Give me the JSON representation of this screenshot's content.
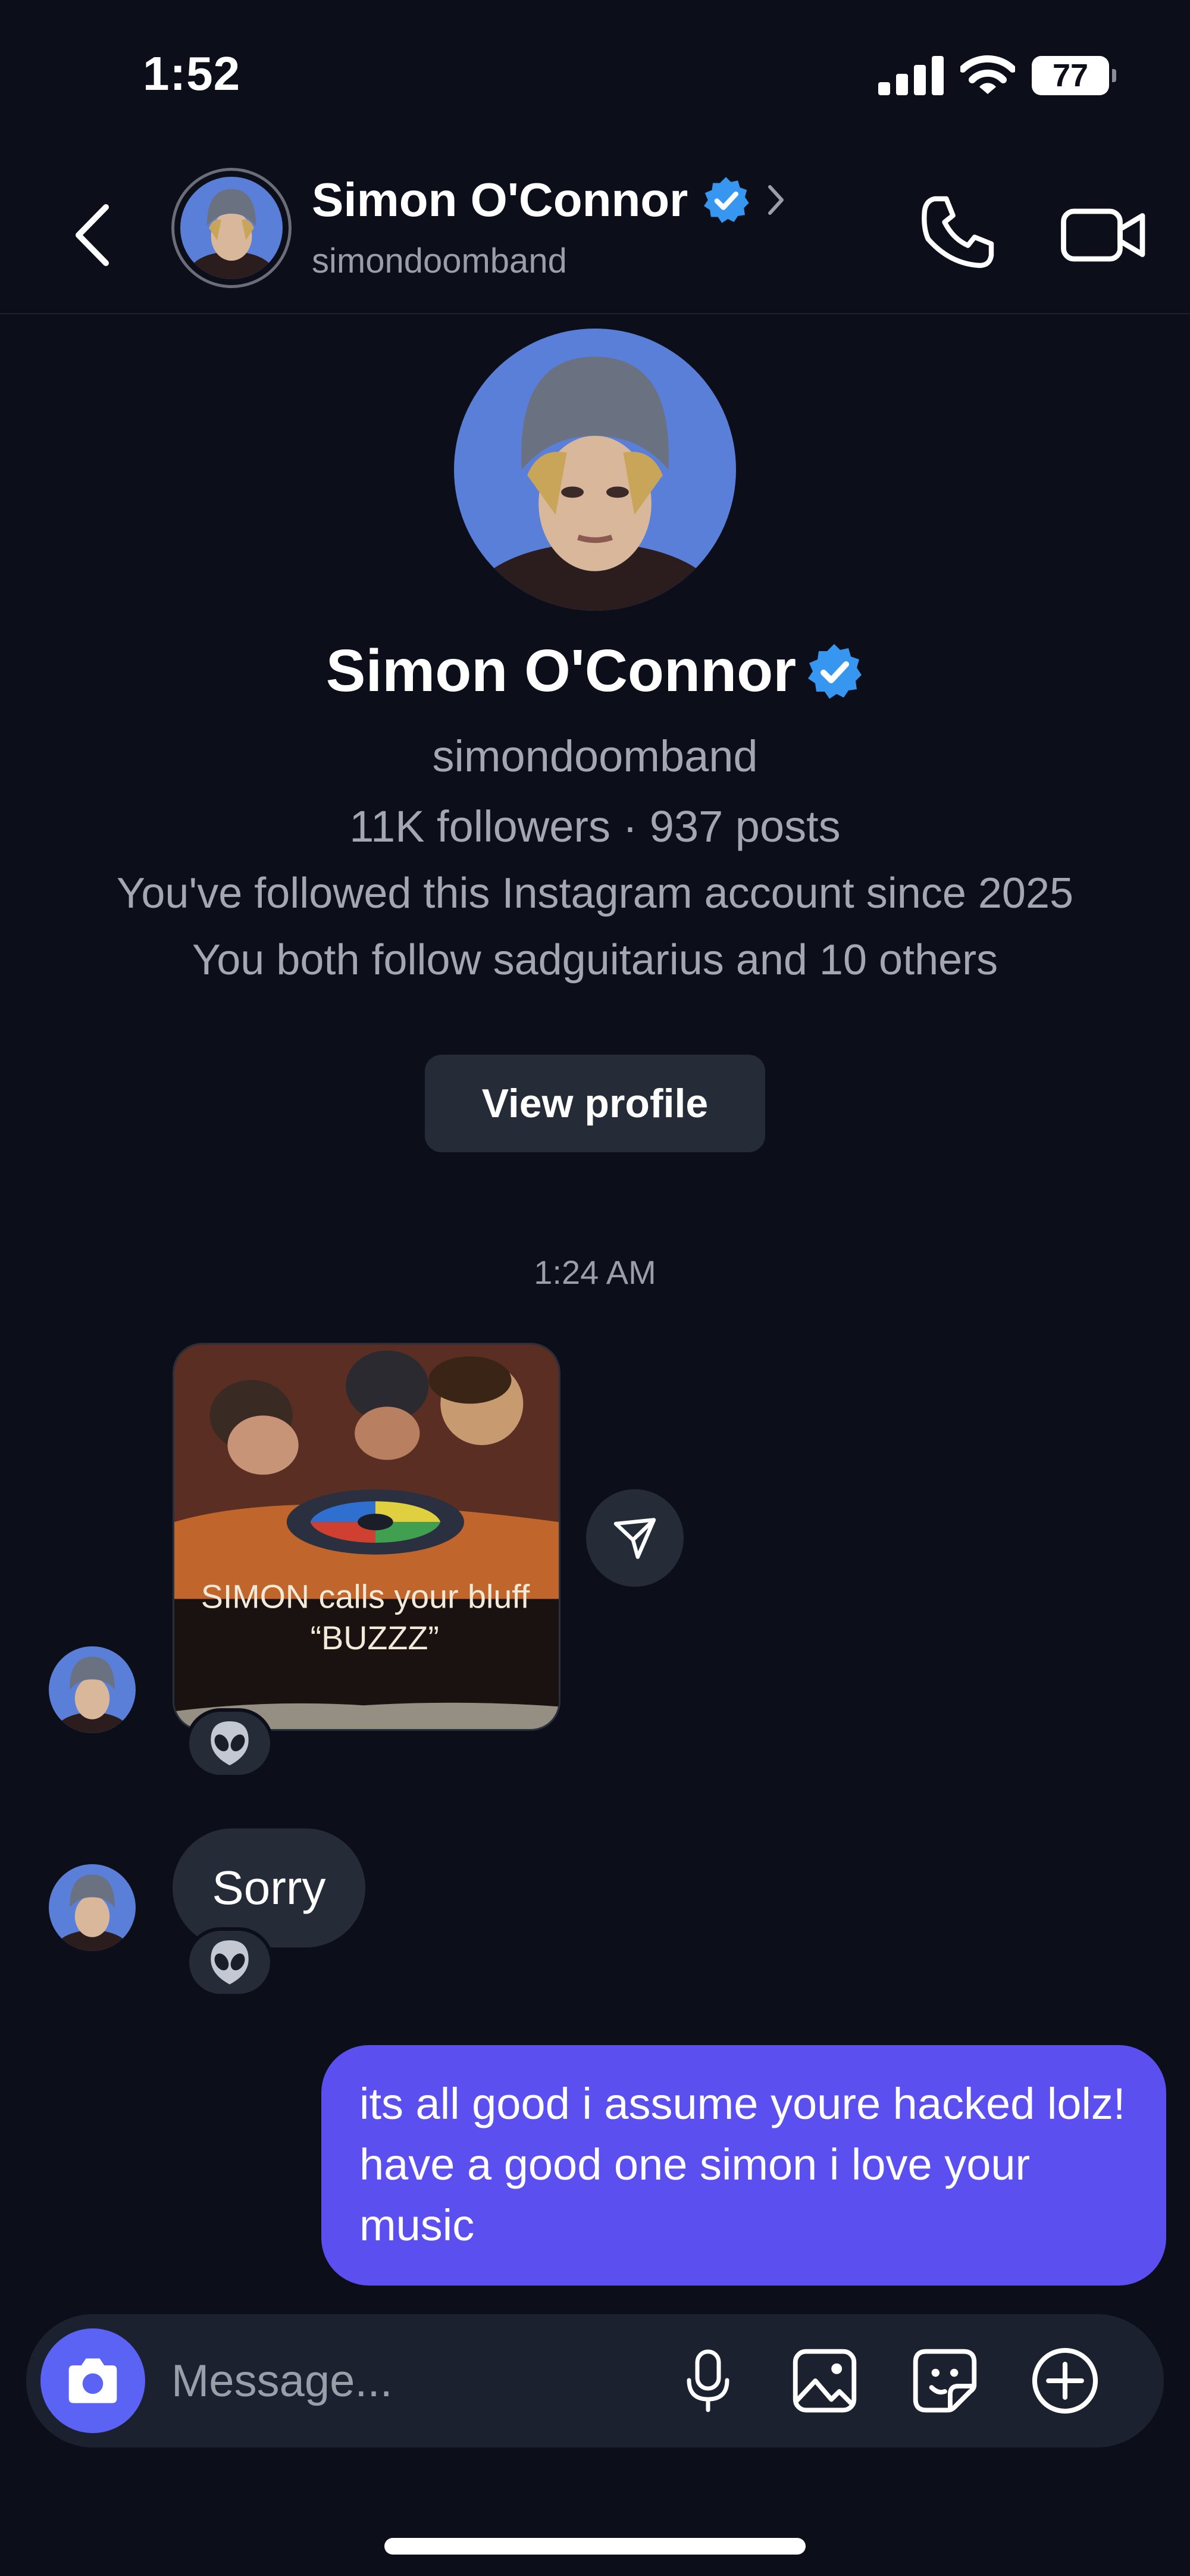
{
  "status_bar": {
    "time": "1:52",
    "battery": "77"
  },
  "header": {
    "name": "Simon O'Connor",
    "handle": "simondoomband"
  },
  "profile": {
    "name": "Simon O'Connor",
    "handle": "simondoomband",
    "stats": "11K followers · 937 posts",
    "followed_since": "You've followed this Instagram account since 2025",
    "mutuals": "You both follow sadguitarius and 10 others",
    "view_profile_label": "View profile"
  },
  "conversation": {
    "timestamp": "1:24 AM",
    "shared_image": {
      "caption_line1": "SIMON calls your bluff",
      "caption_line2": "“BUZZZ”"
    },
    "reaction_emoji": "👽",
    "incoming_text": "Sorry",
    "outgoing_text": "its all good i assume youre hacked lolz! have a good one simon i love your music"
  },
  "composer": {
    "placeholder": "Message..."
  },
  "colors": {
    "background": "#0c0f1a",
    "bubble_incoming": "#262b38",
    "bubble_outgoing": "#5b4ff0",
    "camera_button": "#5b63f5",
    "verified": "#3797f0"
  }
}
